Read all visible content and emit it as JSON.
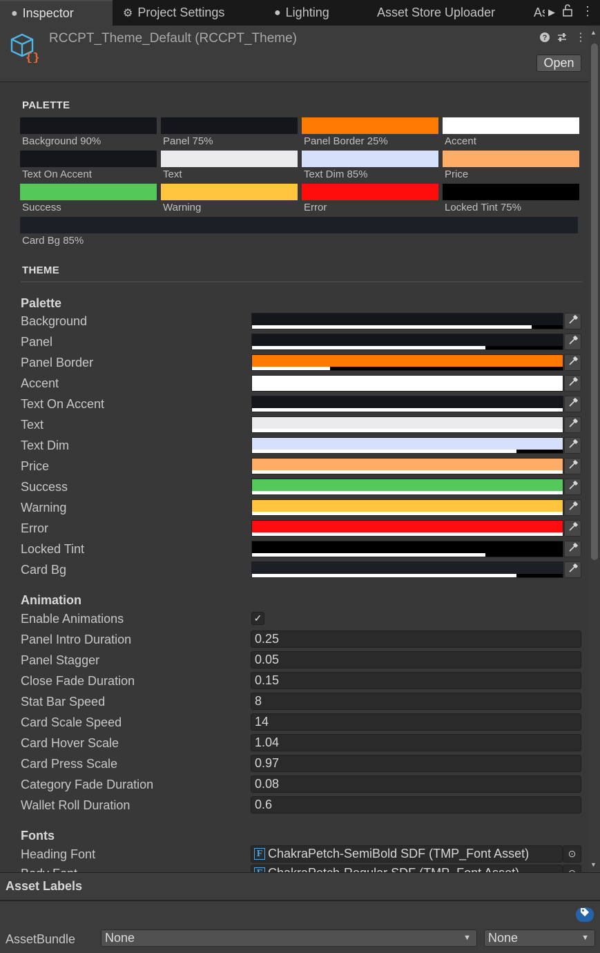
{
  "tabs": [
    {
      "label": "Inspector",
      "icon": "info-icon"
    },
    {
      "label": "Project Settings",
      "icon": "gear-icon"
    },
    {
      "label": "Lighting",
      "icon": "bulb-icon"
    },
    {
      "label": "Asset Store Uploader",
      "icon": ""
    },
    {
      "label": "As",
      "icon": ""
    }
  ],
  "header": {
    "title": "RCCPT_Theme_Default (RCCPT_Theme)",
    "open_label": "Open",
    "icon": "scriptable-object-icon"
  },
  "palette_preview": {
    "heading": "PALETTE",
    "swatches": [
      {
        "label": "Background  90%",
        "color": "#15161b"
      },
      {
        "label": "Panel  75%",
        "color": "#15161b"
      },
      {
        "label": "Panel Border  25%",
        "color": "#ff7a00"
      },
      {
        "label": "Accent",
        "color": "#ffffff"
      },
      {
        "label": "Text On Accent",
        "color": "#15161b"
      },
      {
        "label": "Text",
        "color": "#ebebee"
      },
      {
        "label": "Text Dim  85%",
        "color": "#d6e0fb"
      },
      {
        "label": "Price",
        "color": "#ffad66"
      },
      {
        "label": "Success",
        "color": "#55c85a"
      },
      {
        "label": "Warning",
        "color": "#ffc53e"
      },
      {
        "label": "Error",
        "color": "#ff0d0d"
      },
      {
        "label": "Locked Tint  75%",
        "color": "#000000"
      },
      {
        "label": "Card Bg  85%",
        "color": "#1d1f26"
      }
    ]
  },
  "theme": {
    "heading": "THEME",
    "palette_group": "Palette",
    "colors": [
      {
        "label": "Background",
        "color": "#15161b",
        "alpha": 0.9
      },
      {
        "label": "Panel",
        "color": "#15161b",
        "alpha": 0.75
      },
      {
        "label": "Panel Border",
        "color": "#ff7a00",
        "alpha": 0.25
      },
      {
        "label": "Accent",
        "color": "#ffffff",
        "alpha": 1.0
      },
      {
        "label": "Text On Accent",
        "color": "#15161b",
        "alpha": 1.0
      },
      {
        "label": "Text",
        "color": "#ebebee",
        "alpha": 1.0
      },
      {
        "label": "Text Dim",
        "color": "#d6e0fb",
        "alpha": 0.85
      },
      {
        "label": "Price",
        "color": "#ffad66",
        "alpha": 1.0
      },
      {
        "label": "Success",
        "color": "#55c85a",
        "alpha": 1.0
      },
      {
        "label": "Warning",
        "color": "#ffc53e",
        "alpha": 1.0
      },
      {
        "label": "Error",
        "color": "#ff0d0d",
        "alpha": 1.0
      },
      {
        "label": "Locked Tint",
        "color": "#000000",
        "alpha": 0.75
      },
      {
        "label": "Card Bg",
        "color": "#1d1f26",
        "alpha": 0.85
      }
    ],
    "animation_group": "Animation",
    "enable_animations": {
      "label": "Enable Animations",
      "checked": "✓"
    },
    "animation_fields": [
      {
        "label": "Panel Intro Duration",
        "value": "0.25"
      },
      {
        "label": "Panel Stagger",
        "value": "0.05"
      },
      {
        "label": "Close Fade Duration",
        "value": "0.15"
      },
      {
        "label": "Stat Bar Speed",
        "value": "8"
      },
      {
        "label": "Card Scale Speed",
        "value": "14"
      },
      {
        "label": "Card Hover Scale",
        "value": "1.04"
      },
      {
        "label": "Card Press Scale",
        "value": "0.97"
      },
      {
        "label": "Category Fade Duration",
        "value": "0.08"
      },
      {
        "label": "Wallet Roll Duration",
        "value": "0.6"
      }
    ],
    "fonts_group": "Fonts",
    "font_fields": [
      {
        "label": "Heading Font",
        "value": "ChakraPetch-SemiBold SDF (TMP_Font Asset)"
      },
      {
        "label": "Body Font",
        "value": "ChakraPetch-Regular SDF (TMP_Font Asset)"
      }
    ]
  },
  "footer": {
    "asset_labels": "Asset Labels",
    "assetbundle_label": "AssetBundle",
    "bundle_name": "None",
    "bundle_variant": "None"
  }
}
